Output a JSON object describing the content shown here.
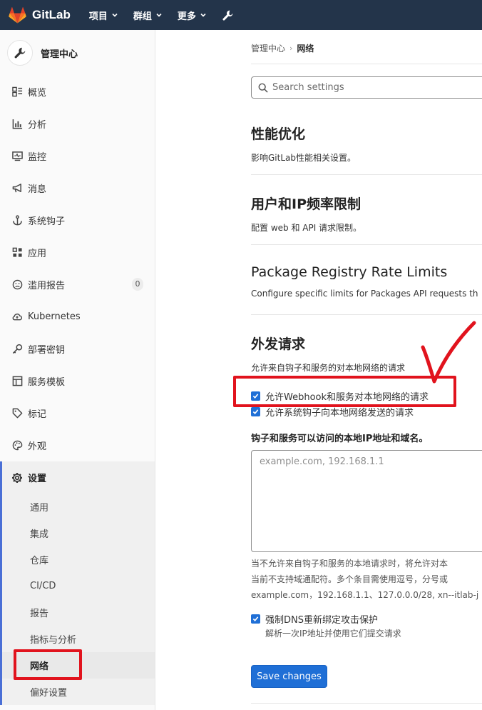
{
  "header": {
    "brand": "GitLab",
    "nav": [
      {
        "label": "项目"
      },
      {
        "label": "群组"
      },
      {
        "label": "更多"
      }
    ]
  },
  "sidebar": {
    "title": "管理中心",
    "items": [
      {
        "label": "概览",
        "icon": "overview-icon"
      },
      {
        "label": "分析",
        "icon": "chart-icon"
      },
      {
        "label": "监控",
        "icon": "monitor-icon"
      },
      {
        "label": "消息",
        "icon": "bullhorn-icon"
      },
      {
        "label": "系统钩子",
        "icon": "anchor-icon"
      },
      {
        "label": "应用",
        "icon": "apps-icon"
      },
      {
        "label": "滥用报告",
        "icon": "emoji-sad-icon",
        "badge": "0"
      },
      {
        "label": "Kubernetes",
        "icon": "cloud-icon"
      },
      {
        "label": "部署密钥",
        "icon": "key-icon"
      },
      {
        "label": "服务模板",
        "icon": "template-icon"
      },
      {
        "label": "标记",
        "icon": "label-icon"
      },
      {
        "label": "外观",
        "icon": "palette-icon"
      }
    ],
    "settings": {
      "label": "设置",
      "subitems": [
        "通用",
        "集成",
        "仓库",
        "CI/CD",
        "报告",
        "指标与分析",
        "网络",
        "偏好设置"
      ],
      "current": "网络"
    }
  },
  "breadcrumb": {
    "parent": "管理中心",
    "current": "网络"
  },
  "search": {
    "placeholder": "Search settings"
  },
  "sections": {
    "perf": {
      "title": "性能优化",
      "desc": "影响GitLab性能相关设置。"
    },
    "rate": {
      "title": "用户和IP频率限制",
      "desc": "配置 web 和 API 请求限制。"
    },
    "pkg": {
      "title": "Package Registry Rate Limits",
      "desc": "Configure specific limits for Packages API requests th"
    },
    "outbound": {
      "title": "外发请求",
      "desc": "允许来自钩子和服务的对本地网络的请求",
      "cb1": "允许Webhook和服务对本地网络的请求",
      "cb2": "允许系统钩子向本地网络发送的请求",
      "field_label": "钩子和服务可以访问的本地IP地址和域名。",
      "field_placeholder": "example.com, 192.168.1.1",
      "help1": "当不允许来自钩子和服务的本地请求时，将允许对本",
      "help2": "当前不支持域通配符。多个条目需使用逗号，分号或",
      "help3": "example.com，192.168.1.1、127.0.0.0/28, xn--itlab-j",
      "dns_label": "强制DNS重新绑定攻击保护",
      "dns_help": "解析一次IP地址并使用它们提交请求",
      "save": "Save changes"
    }
  },
  "colors": {
    "header_bg": "#23344a",
    "accent": "#1f6fd6",
    "annotation": "#e1131d"
  }
}
